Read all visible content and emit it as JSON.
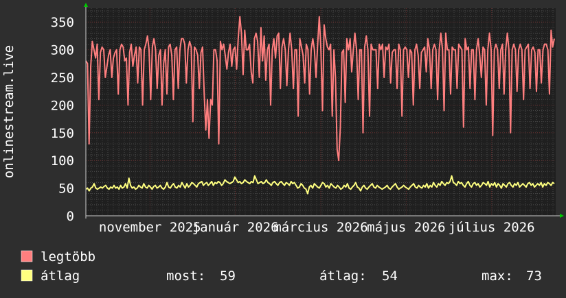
{
  "chart_data": {
    "type": "line",
    "ylabel": "onlinestream.live",
    "ylim": [
      0,
      375
    ],
    "yticks": [
      0,
      50,
      100,
      150,
      200,
      250,
      300,
      350
    ],
    "xticks": [
      "november 2025",
      "január 2026",
      "március 2026",
      "május 2026",
      "július 2026"
    ],
    "grid": true,
    "colors": {
      "background": "#2e2e2e",
      "plot_background": "#1f1f1f",
      "grid": "#4a4a4a",
      "major_grid": "#6a3030",
      "axis": "#cccccc",
      "text": "#ffffff",
      "max_series": "#ff7f7f",
      "avg_series": "#ffff80"
    },
    "series": [
      {
        "name": "legtöbb",
        "color": "#ff7f7f",
        "values": [
          280,
          275,
          130,
          270,
          315,
          300,
          285,
          310,
          210,
          295,
          305,
          300,
          250,
          270,
          290,
          300,
          250,
          285,
          295,
          300,
          220,
          300,
          310,
          305,
          280,
          285,
          200,
          295,
          310,
          270,
          290,
          305,
          240,
          305,
          300,
          200,
          300,
          310,
          325,
          300,
          210,
          305,
          320,
          300,
          230,
          290,
          300,
          200,
          275,
          300,
          220,
          305,
          310,
          290,
          210,
          300,
          305,
          230,
          300,
          320,
          320,
          310,
          240,
          300,
          315,
          305,
          170,
          305,
          300,
          290,
          230,
          295,
          305,
          220,
          155,
          210,
          140,
          210,
          200,
          300,
          300,
          280,
          130,
          315,
          300,
          310,
          290,
          265,
          295,
          310,
          270,
          300,
          305,
          265,
          320,
          360,
          330,
          255,
          335,
          300,
          300,
          310,
          260,
          240,
          320,
          330,
          315,
          250,
          340,
          280,
          325,
          245,
          300,
          310,
          200,
          300,
          320,
          285,
          325,
          330,
          230,
          305,
          320,
          300,
          235,
          300,
          330,
          300,
          230,
          300,
          300,
          180,
          320,
          305,
          290,
          240,
          310,
          300,
          220,
          300,
          320,
          300,
          250,
          310,
          360,
          300,
          190,
          345,
          320,
          305,
          300,
          310,
          180,
          300,
          250,
          120,
          100,
          160,
          295,
          300,
          205,
          320,
          300,
          320,
          260,
          300,
          330,
          300,
          210,
          300,
          300,
          150,
          305,
          325,
          300,
          180,
          310,
          300,
          300,
          300,
          230,
          310,
          300,
          310,
          250,
          305,
          300,
          310,
          240,
          295,
          300,
          300,
          230,
          310,
          300,
          180,
          300,
          305,
          300,
          250,
          300,
          295,
          200,
          300,
          310,
          290,
          230,
          295,
          300,
          305,
          260,
          320,
          300,
          230,
          300,
          310,
          300,
          210,
          300,
          330,
          300,
          190,
          330,
          300,
          300,
          220,
          305,
          300,
          300,
          230,
          310,
          305,
          300,
          160,
          320,
          300,
          305,
          230,
          300,
          300,
          210,
          300,
          320,
          290,
          250,
          305,
          300,
          200,
          300,
          330,
          300,
          145,
          300,
          310,
          300,
          230,
          300,
          310,
          220,
          300,
          330,
          300,
          150,
          300,
          310,
          300,
          225,
          300,
          310,
          300,
          210,
          300,
          305,
          310,
          230,
          300,
          305,
          295,
          225,
          300,
          300,
          240,
          300,
          310,
          310,
          300,
          220,
          335,
          305,
          320
        ]
      },
      {
        "name": "átlag",
        "color": "#ffff80",
        "values": [
          48,
          50,
          45,
          50,
          52,
          58,
          50,
          48,
          50,
          52,
          50,
          53,
          55,
          50,
          48,
          52,
          50,
          55,
          50,
          52,
          48,
          55,
          50,
          52,
          58,
          50,
          68,
          55,
          50,
          52,
          48,
          50,
          55,
          52,
          50,
          58,
          52,
          50,
          55,
          52,
          48,
          53,
          55,
          50,
          52,
          55,
          50,
          48,
          52,
          60,
          52,
          50,
          55,
          58,
          52,
          50,
          55,
          52,
          60,
          55,
          50,
          58,
          52,
          55,
          60,
          58,
          55,
          52,
          58,
          60,
          62,
          55,
          58,
          60,
          55,
          58,
          62,
          55,
          60,
          58,
          62,
          60,
          55,
          58,
          65,
          62,
          60,
          58,
          60,
          62,
          70,
          65,
          60,
          62,
          58,
          60,
          65,
          62,
          60,
          58,
          62,
          60,
          72,
          65,
          58,
          60,
          62,
          58,
          60,
          65,
          60,
          58,
          55,
          60,
          62,
          58,
          55,
          60,
          62,
          58,
          55,
          60,
          58,
          55,
          62,
          58,
          60,
          55,
          50,
          52,
          58,
          55,
          50,
          48,
          40,
          52,
          55,
          50,
          58,
          55,
          52,
          50,
          55,
          60,
          58,
          52,
          55,
          50,
          58,
          55,
          52,
          50,
          55,
          52,
          48,
          50,
          55,
          52,
          58,
          50,
          48,
          52,
          55,
          60,
          52,
          50,
          45,
          52,
          55,
          50,
          48,
          52,
          55,
          58,
          52,
          50,
          55,
          52,
          50,
          48,
          50,
          52,
          55,
          50,
          48,
          52,
          55,
          58,
          52,
          48,
          50,
          52,
          55,
          52,
          50,
          48,
          52,
          55,
          58,
          52,
          50,
          55,
          52,
          50,
          55,
          52,
          58,
          50,
          55,
          52,
          60,
          55,
          52,
          58,
          55,
          62,
          58,
          55,
          60,
          58,
          62,
          72,
          60,
          58,
          55,
          62,
          58,
          60,
          55,
          52,
          58,
          62,
          55,
          52,
          58,
          60,
          55,
          58,
          52,
          55,
          60,
          58,
          55,
          62,
          52,
          58,
          55,
          60,
          52,
          58,
          55,
          50,
          58,
          55,
          52,
          58,
          60,
          55,
          52,
          58,
          55,
          60,
          52,
          55,
          58,
          55,
          52,
          58,
          60,
          55,
          58,
          52,
          55,
          58,
          55,
          60,
          52,
          58,
          55,
          60,
          58,
          55,
          60,
          58
        ]
      }
    ],
    "legend": {
      "placement": "bottom-left",
      "items": [
        {
          "label": "legtöbb",
          "color": "#ff7f7f"
        },
        {
          "label": "átlag",
          "color": "#ffff80"
        }
      ]
    },
    "stats": {
      "current_label": "most:",
      "current_value": "59",
      "avg_label": "átlag:",
      "avg_value": "54",
      "max_label": "max:",
      "max_value": "73"
    }
  }
}
